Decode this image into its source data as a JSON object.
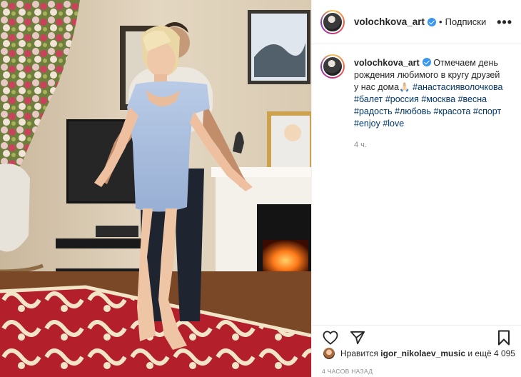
{
  "post": {
    "username": "volochkova_art",
    "follow_label": "Подписки",
    "separator": "•",
    "more_label": "•••",
    "caption": {
      "username": "volochkova_art",
      "text": "Отмечаем день рождения любимого в кругу друзей у нас дома🙏🏻",
      "hashtags": [
        "#анастасияволочкова",
        "#балет",
        "#россия",
        "#москва",
        "#весна",
        "#радость",
        "#любовь",
        "#красота",
        "#спорт",
        "#enjoy",
        "#love"
      ]
    },
    "time_ago": "4 ч.",
    "likes": {
      "prefix": "Нравится",
      "user": "igor_nikolaev_music",
      "suffix": "и ещё 4 095"
    },
    "posted_at": "4 ЧАСОВ НАЗАД"
  },
  "icons": {
    "verified": "verified-badge-icon",
    "like": "heart-icon",
    "share": "paper-plane-icon",
    "save": "bookmark-icon",
    "more": "more-options-icon"
  },
  "colors": {
    "hashtag": "#00376b",
    "verified": "#3897f0",
    "muted": "#8e8e8e"
  }
}
